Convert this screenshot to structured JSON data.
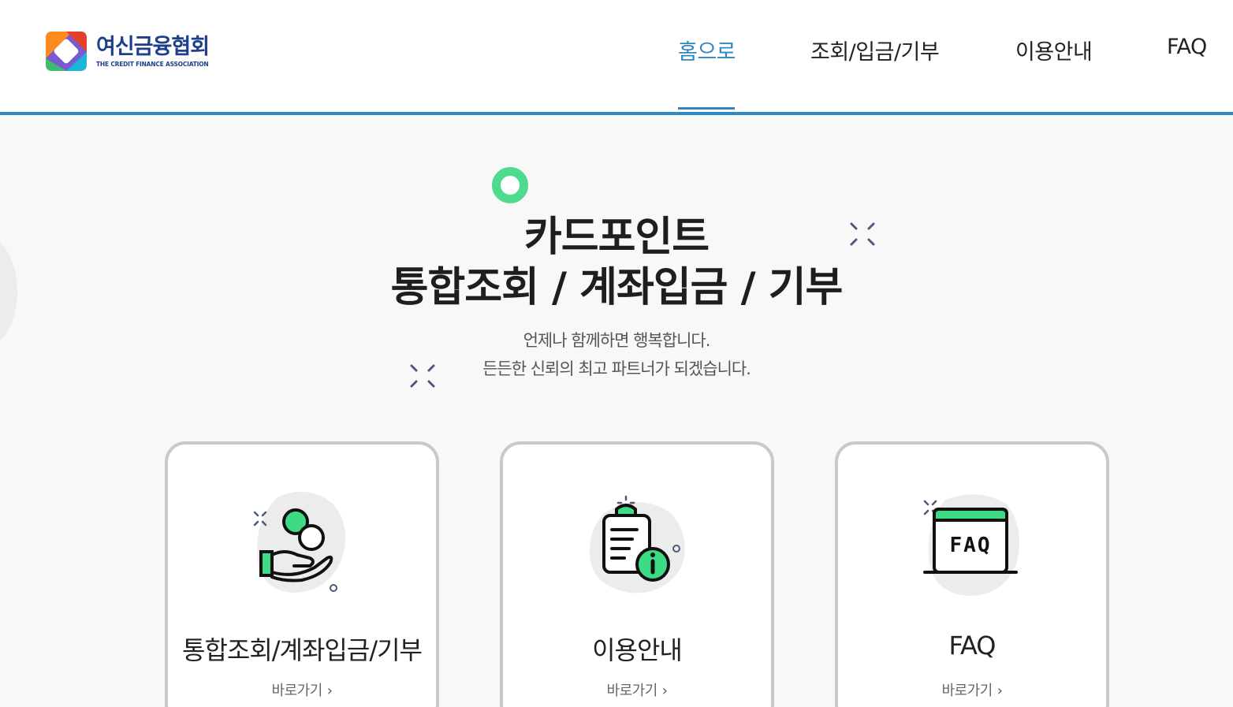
{
  "header": {
    "logo": {
      "name_ko": "여신금융협회",
      "name_en": "THE CREDIT FINANCE ASSOCIATION"
    },
    "nav": [
      {
        "label": "홈으로",
        "active": true
      },
      {
        "label": "조회/입금/기부",
        "active": false
      },
      {
        "label": "이용안내",
        "active": false
      },
      {
        "label": "FAQ",
        "active": false
      }
    ],
    "accent_color": "#2d87c3"
  },
  "hero": {
    "title_line1": "카드포인트",
    "title_line2": "통합조회 / 계좌입금 / 기부",
    "subtitle_line1": "언제나 함께하면 행복합니다.",
    "subtitle_line2": "든든한 신뢰의 최고 파트너가 되겠습니다."
  },
  "cards": [
    {
      "title": "통합조회/계좌입금/기부",
      "link": "바로가기",
      "icon": "hand-coins-icon"
    },
    {
      "title": "이용안내",
      "link": "바로가기",
      "icon": "clipboard-info-icon"
    },
    {
      "title": "FAQ",
      "link": "바로가기",
      "icon": "faq-window-icon"
    }
  ],
  "colors": {
    "green": "#3ddc84",
    "card_border": "#c9c9c9"
  }
}
